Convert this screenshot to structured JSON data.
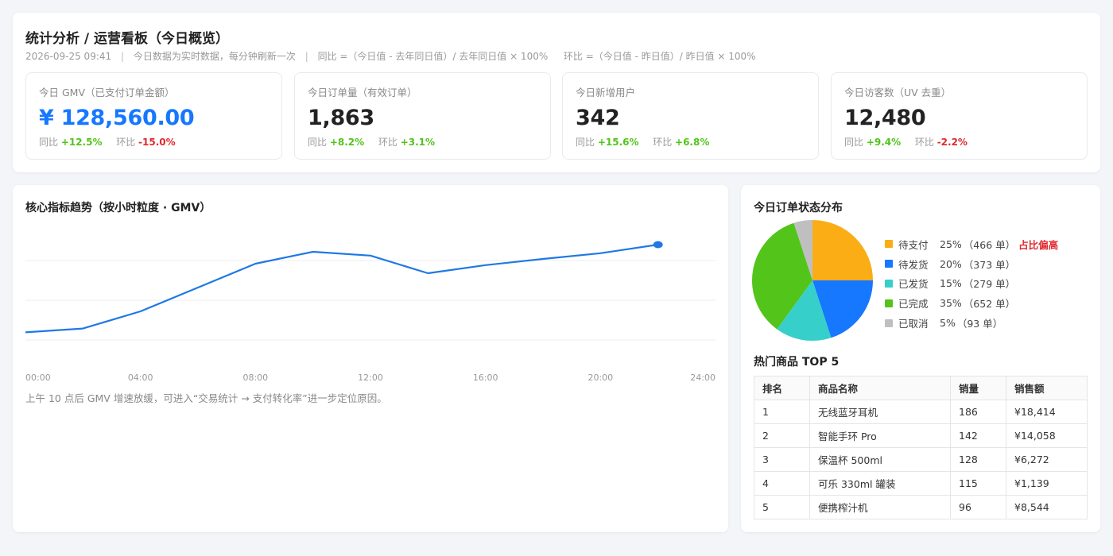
{
  "header": {
    "title": "统计分析 / 运营看板（今日概览）",
    "timestamp": "2026-09-25 09:41",
    "refresh_note": "今日数据为实时数据，每分钟刷新一次",
    "yoy_formula": "同比 =（今日值 - 去年同日值）/ 去年同日值 × 100%",
    "mom_formula": "环比 =（今日值 - 昨日值）/ 昨日值 × 100%",
    "separator": "|"
  },
  "kpis": [
    {
      "label": "今日 GMV（已支付订单金额）",
      "value": "¥ 128,560.00",
      "yoy_label": "同比",
      "yoy": "+12.5%",
      "mom_label": "环比",
      "mom": "-15.0%"
    },
    {
      "label": "今日订单量（有效订单）",
      "value": "1,863",
      "yoy_label": "同比",
      "yoy": "+8.2%",
      "mom_label": "环比",
      "mom": "+3.1%"
    },
    {
      "label": "今日新增用户",
      "value": "342",
      "yoy_label": "同比",
      "yoy": "+15.6%",
      "mom_label": "环比",
      "mom": "+6.8%"
    },
    {
      "label": "今日访客数（UV 去重）",
      "value": "12,480",
      "yoy_label": "同比",
      "yoy": "+9.4%",
      "mom_label": "环比",
      "mom": "-2.2%"
    }
  ],
  "trend": {
    "title": "核心指标趋势（按小时粒度 · GMV）",
    "note": "上午 10 点后 GMV 增速放缓，可进入“交易统计 → 支付转化率”进一步定位原因。",
    "chart_data": {
      "type": "line",
      "x": [
        0,
        2,
        4,
        6,
        8,
        10,
        12,
        14,
        16,
        18,
        20,
        22
      ],
      "values": [
        0.16,
        0.24,
        0.6,
        1.1,
        1.6,
        1.85,
        1.77,
        1.4,
        1.57,
        1.7,
        1.82,
        2.0
      ],
      "x_ticks": [
        "00:00",
        "04:00",
        "08:00",
        "12:00",
        "16:00",
        "20:00",
        "24:00"
      ],
      "xlim": [
        0,
        24
      ],
      "ylim": [
        0,
        2.5
      ],
      "grid": true,
      "color": "#1f78e6"
    }
  },
  "status": {
    "title": "今日订单状态分布",
    "chart_data": {
      "type": "pie",
      "slices": [
        {
          "name": "待支付",
          "percent": 25,
          "pct_label": "25%",
          "count_label": "（466 单）",
          "color": "#faad14",
          "badge": "占比偏高"
        },
        {
          "name": "待发货",
          "percent": 20,
          "pct_label": "20%",
          "count_label": "（373 单）",
          "color": "#1677ff",
          "badge": ""
        },
        {
          "name": "已发货",
          "percent": 15,
          "pct_label": "15%",
          "count_label": "（279 单）",
          "color": "#36cfc9",
          "badge": ""
        },
        {
          "name": "已完成",
          "percent": 35,
          "pct_label": "35%",
          "count_label": "（652 单）",
          "color": "#52c41a",
          "badge": ""
        },
        {
          "name": "已取消",
          "percent": 5,
          "pct_label": "5%",
          "count_label": "（93 单）",
          "color": "#bfbfbf",
          "badge": ""
        }
      ]
    }
  },
  "top5": {
    "title": "热门商品 TOP 5",
    "columns": [
      "排名",
      "商品名称",
      "销量",
      "销售额"
    ],
    "rows": [
      [
        "1",
        "无线蓝牙耳机",
        "186",
        "¥18,414"
      ],
      [
        "2",
        "智能手环 Pro",
        "142",
        "¥14,058"
      ],
      [
        "3",
        "保温杯 500ml",
        "128",
        "¥6,272"
      ],
      [
        "4",
        "可乐 330ml 罐装",
        "115",
        "¥1,139"
      ],
      [
        "5",
        "便携榨汁机",
        "96",
        "¥8,544"
      ]
    ]
  },
  "colors": {
    "accent": "#1677ff",
    "positive": "#52c41a",
    "negative": "#e0282e"
  }
}
